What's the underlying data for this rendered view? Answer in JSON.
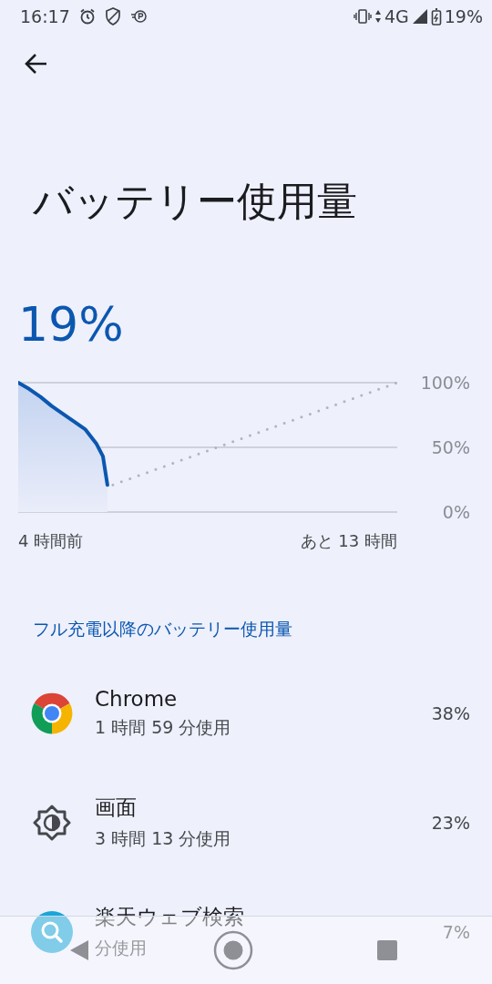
{
  "status_bar": {
    "time": "16:17",
    "network": "4G",
    "battery": "19%"
  },
  "title": "バッテリー使用量",
  "battery_level": "19%",
  "chart": {
    "y_labels": [
      "100%",
      "50%",
      "0%"
    ],
    "time_labels": [
      "4 時間前",
      "あと 13 時間"
    ]
  },
  "section_header": "フル充電以降のバッテリー使用量",
  "apps": [
    {
      "kind": "chrome",
      "name": "Chrome",
      "usage": "1 時間 59 分使用",
      "percent": "38%"
    },
    {
      "kind": "screen",
      "name": "画面",
      "usage": "3 時間 13 分使用",
      "percent": "23%"
    },
    {
      "kind": "search",
      "name": "楽天ウェブ検索",
      "usage": "分使用",
      "percent": "7%"
    }
  ]
}
